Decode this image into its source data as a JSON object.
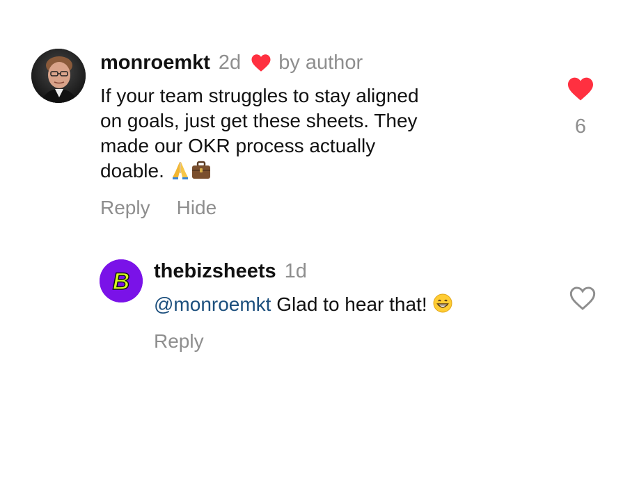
{
  "comments": [
    {
      "username": "monroemkt",
      "time": "2d",
      "liked_by_author": true,
      "by_author_label": "by author",
      "text": "If your team struggles to stay aligned on goals, just get these sheets. They made our OKR process actually doable.",
      "emojis": [
        "folded-hands",
        "briefcase"
      ],
      "actions": {
        "reply": "Reply",
        "hide": "Hide"
      },
      "like_state": "liked",
      "like_count": "6"
    }
  ],
  "reply": {
    "username": "thebizsheets",
    "avatar_letter": "B",
    "time": "1d",
    "mention": "@monroemkt",
    "text": "Glad to hear that!",
    "emoji": "grinning-face",
    "actions": {
      "reply": "Reply"
    },
    "like_state": "not-liked"
  },
  "colors": {
    "heart_red": "#ff3040",
    "muted_text": "#8e8e8e",
    "mention_blue": "#1c4f7d",
    "reply_avatar_bg": "#7a12e8",
    "reply_avatar_letter": "#d7ff1f"
  }
}
